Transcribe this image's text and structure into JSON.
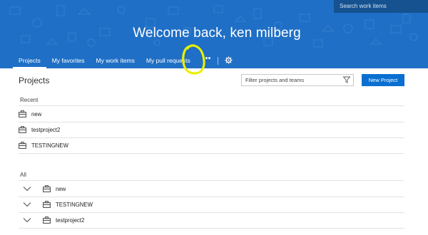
{
  "header": {
    "search_placeholder": "Search work items",
    "welcome": "Welcome back, ken milberg",
    "background_color": "#1f6fc6"
  },
  "nav": {
    "tabs": [
      {
        "label": "Projects",
        "active": true
      },
      {
        "label": "My favorites",
        "active": false
      },
      {
        "label": "My work items",
        "active": false
      },
      {
        "label": "My pull requests",
        "active": false
      }
    ],
    "more_label": "•••",
    "settings_icon": "gear-icon"
  },
  "main": {
    "title": "Projects",
    "filter_placeholder": "Filter projects and teams",
    "new_project_label": "New Project",
    "accent_color": "#0a6fd1"
  },
  "recent": {
    "label": "Recent",
    "items": [
      "new",
      "testproject2",
      "TESTINGNEW"
    ]
  },
  "all": {
    "label": "All",
    "items": [
      "new",
      "TESTINGNEW",
      "testproject2"
    ]
  },
  "annotation_color": "#e8f000"
}
